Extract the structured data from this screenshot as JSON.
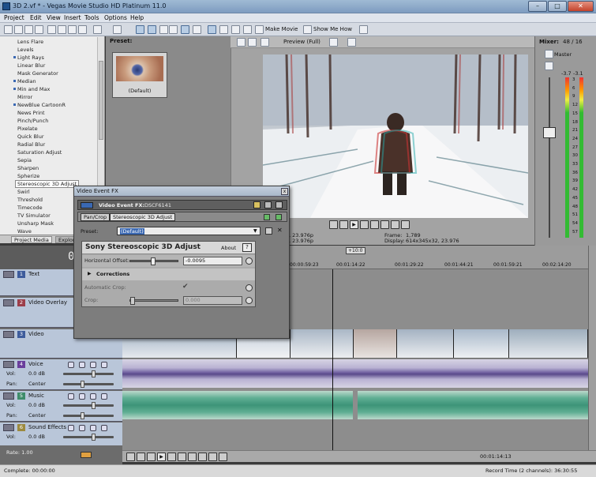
{
  "window": {
    "title": "3D 2.vf * - Vegas Movie Studio HD Platinum 11.0",
    "min": "–",
    "max": "□",
    "close": "✕"
  },
  "menu": [
    "Project",
    "Edit",
    "View",
    "Insert",
    "Tools",
    "Options",
    "Help"
  ],
  "toolbar": {
    "make_movie": "Make Movie",
    "show_me_how": "Show Me How"
  },
  "fx_list": {
    "items": [
      "Lens Flare",
      "Levels",
      "Light Rays",
      "Linear Blur",
      "Mask Generator",
      "Median",
      "Min and Max",
      "Mirror",
      "NewBlue CartoonR",
      "News Print",
      "Pinch/Punch",
      "Pixelate",
      "Quick Blur",
      "Radial Blur",
      "Saturation Adjust",
      "Sepia",
      "Sharpen",
      "Spherize",
      "Stereoscopic 3D Adjust",
      "Swirl",
      "Threshold",
      "Timecode",
      "TV Simulator",
      "Unsharp Mask",
      "Wave"
    ],
    "dotted": [
      2,
      5,
      6,
      8
    ],
    "selected_index": 18
  },
  "preset_panel": {
    "label": "Preset:",
    "thumb_name": "(Default)"
  },
  "left_tabs": [
    "Project Media",
    "Explorer"
  ],
  "preview": {
    "mode": "Preview (Full)",
    "info_left": [
      ", 23.976p",
      ", 23.976p"
    ],
    "frame_label": "Frame:",
    "frame_value": "1,789",
    "display_label": "Display:",
    "display_value": "614x345x32, 23.976"
  },
  "mixer": {
    "title": "Mixer:",
    "count": "48 / 16",
    "master": "Master",
    "peak_left": "-3.7",
    "peak_right": "-3.1",
    "scale": [
      "3",
      "6",
      "9",
      "12",
      "15",
      "18",
      "21",
      "24",
      "27",
      "30",
      "33",
      "36",
      "39",
      "42",
      "45",
      "48",
      "51",
      "54",
      "57"
    ]
  },
  "timeline": {
    "time": "00",
    "ruler": [
      "00:00:59:23",
      "00:01:14:22",
      "00:01:29:22",
      "00:01:44:21",
      "00:01:59:21",
      "00:02:14:20"
    ],
    "cursor_tag": "+10:0",
    "end_time": "00:01:14:13"
  },
  "tracks": [
    {
      "num": "1",
      "name": "Text",
      "color": "#3e5c9c",
      "type": "video"
    },
    {
      "num": "2",
      "name": "Video Overlay",
      "color": "#9c3e4a",
      "type": "video"
    },
    {
      "num": "3",
      "name": "Video",
      "color": "#3e5c9c",
      "type": "video"
    },
    {
      "num": "4",
      "name": "Voice",
      "color": "#6a3e9c",
      "type": "audio",
      "vol_label": "Vol:",
      "vol": "0.0 dB",
      "pan_label": "Pan:",
      "pan": "Center"
    },
    {
      "num": "5",
      "name": "Music",
      "color": "#3e8c6a",
      "type": "audio",
      "vol_label": "Vol:",
      "vol": "0.0 dB",
      "pan_label": "Pan:",
      "pan": "Center"
    },
    {
      "num": "6",
      "name": "Sound Effects",
      "color": "#9c8a3e",
      "type": "audio",
      "vol_label": "Vol:",
      "vol": "0.0 dB"
    }
  ],
  "rate": "Rate: 1.00",
  "status": {
    "left": "Complete: 00:00:00",
    "right": "Record Time (2 channels): 36:30:55"
  },
  "fx_dialog": {
    "title": "Video Event FX",
    "close": "x",
    "header_label": "Video Event FX:",
    "header_value": "DSCF6141",
    "chain": [
      "Pan/Crop",
      "Stereoscopic 3D Adjust"
    ],
    "preset_label": "Preset:",
    "preset_value": "(Default)",
    "plugin_name": "Sony Stereoscopic 3D Adjust",
    "about": "About",
    "help": "?",
    "params": [
      {
        "label": "Horizontal Offset:",
        "value": "-0.0095",
        "level": 0.45
      },
      {
        "label": "Corrections",
        "value": ""
      },
      {
        "label": "Automatic Crop:",
        "value": ""
      },
      {
        "label": "Crop:",
        "value": "0.000",
        "level": 0.0
      }
    ]
  },
  "colors": {
    "accent": "#3a68b2",
    "titlebar": "#9fbad4"
  }
}
